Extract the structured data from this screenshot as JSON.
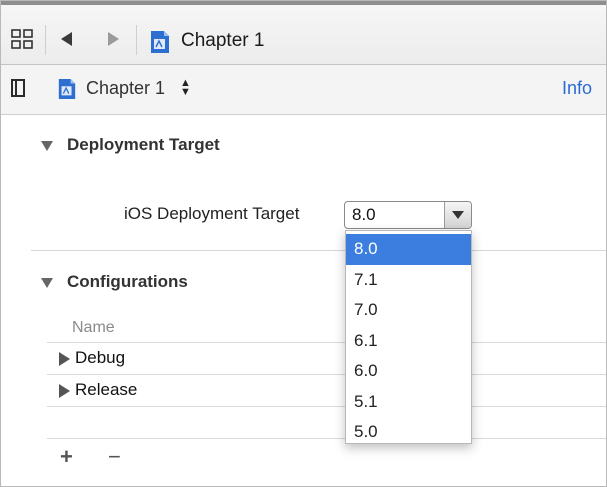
{
  "nav": {
    "title": "Chapter 1"
  },
  "toolbar": {
    "target_name": "Chapter 1",
    "info_label": "Info"
  },
  "deployment": {
    "header": "Deployment Target",
    "field_label": "iOS Deployment Target",
    "selected_value": "8.0",
    "options": [
      "8.0",
      "7.1",
      "7.0",
      "6.1",
      "6.0",
      "5.1",
      "5.0"
    ]
  },
  "configurations": {
    "header": "Configurations",
    "column_name": "Name",
    "rows": [
      "Debug",
      "Release"
    ],
    "add_label": "+",
    "remove_label": "−"
  },
  "colors": {
    "accent": "#2c6bd0",
    "selection": "#3b7ee0"
  }
}
